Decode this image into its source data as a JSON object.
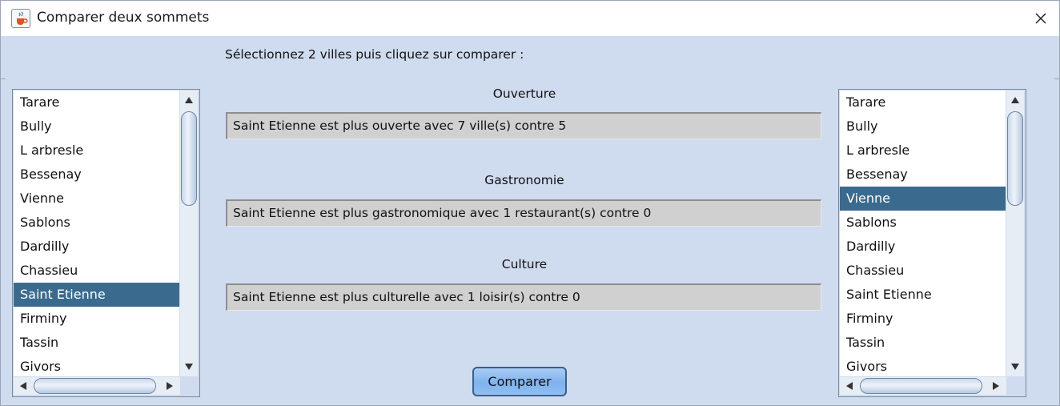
{
  "window": {
    "title": "Comparer deux sommets",
    "app_icon": "java-cup-icon",
    "close_icon": "close-icon"
  },
  "instruction": "Sélectionnez 2 villes puis cliquez sur comparer :",
  "sections": [
    {
      "label": "Ouverture",
      "value": "Saint Etienne est plus ouverte avec 7 ville(s) contre 5"
    },
    {
      "label": "Gastronomie",
      "value": "Saint Etienne est plus gastronomique avec 1 restaurant(s) contre 0"
    },
    {
      "label": "Culture",
      "value": "Saint Etienne est plus culturelle avec 1 loisir(s) contre 0"
    }
  ],
  "left_list": {
    "items": [
      "Tarare",
      "Bully",
      "L arbresle",
      "Bessenay",
      "Vienne",
      "Sablons",
      "Dardilly",
      "Chassieu",
      "Saint Etienne",
      "Firminy",
      "Tassin",
      "Givors"
    ],
    "selected": "Saint Etienne"
  },
  "right_list": {
    "items": [
      "Tarare",
      "Bully",
      "L arbresle",
      "Bessenay",
      "Vienne",
      "Sablons",
      "Dardilly",
      "Chassieu",
      "Saint Etienne",
      "Firminy",
      "Tassin",
      "Givors"
    ],
    "selected": "Vienne"
  },
  "compare_button": "Comparer",
  "colors": {
    "panel_bg": "#cfdbee",
    "selection": "#3a6b8e",
    "result_field": "#d0d0d0",
    "button": "#8fbef2"
  }
}
